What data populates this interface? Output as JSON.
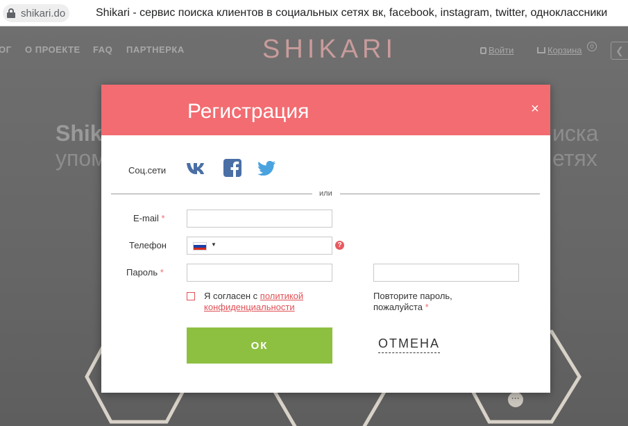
{
  "browser": {
    "url": "shikari.do",
    "title": "Shikari - сервис поиска клиентов в социальных сетях вк, facebook, instagram, twitter, одноклассники"
  },
  "site": {
    "nav": [
      "ОГ",
      "О ПРОЕКТЕ",
      "FAQ",
      "ПАРТНЕРКА"
    ],
    "logo": "SHIKARI",
    "login": "Войти",
    "cart": "Корзина",
    "cart_count": "0",
    "hero_left_bold": "Shik",
    "hero_left_line2": "упом",
    "hero_right_line1": "иска",
    "hero_right_line2": "етях"
  },
  "modal": {
    "title": "Регистрация",
    "close": "×",
    "social_label": "Соц.сети",
    "social_icons": [
      "vk-icon",
      "facebook-icon",
      "twitter-icon"
    ],
    "divider_text": "или",
    "email_label": "E-mail",
    "phone_label": "Телефон",
    "phone_flag": "RU",
    "password_label": "Пароль",
    "required_mark": "*",
    "help_glyph": "?",
    "agree_prefix": "Я согласен с ",
    "agree_link": "политикой конфиденциальности",
    "repeat_hint": "Повторите пароль, пожалуйста",
    "ok_label": "ОК",
    "cancel_label": "ОТМЕНА"
  },
  "colors": {
    "header": "#f26c71",
    "ok": "#8dc041",
    "accent": "#e05055"
  }
}
